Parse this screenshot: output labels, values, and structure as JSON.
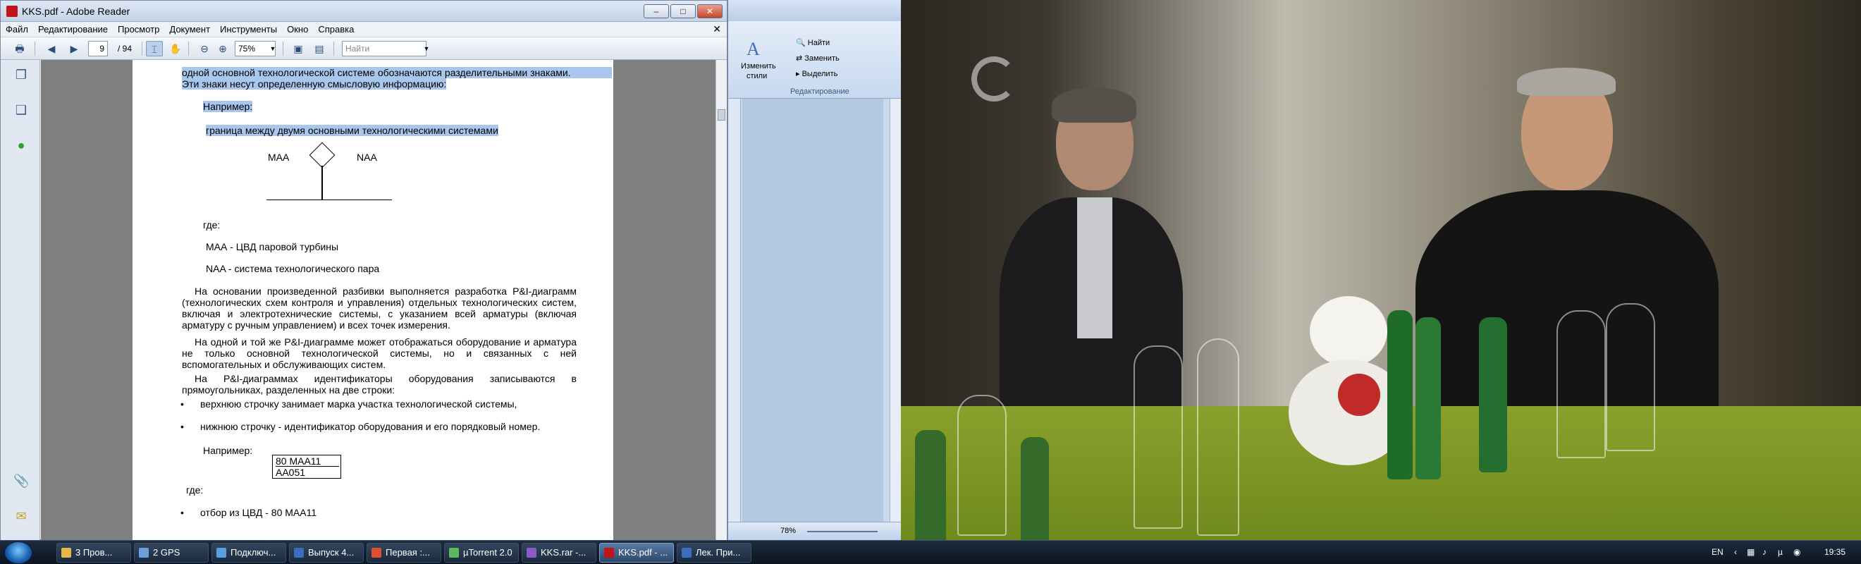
{
  "reader": {
    "title": "KKS.pdf - Adobe Reader",
    "window_buttons": [
      "–",
      "□",
      "✕"
    ],
    "menu": [
      "Файл",
      "Редактирование",
      "Просмотр",
      "Документ",
      "Инструменты",
      "Окно",
      "Справка"
    ],
    "toolbar": {
      "page_current": "9",
      "page_total": "/ 94",
      "zoom": "75%",
      "find_placeholder": "Найти"
    },
    "page": {
      "line1": "одной основной технологической системе обозначаются разделительными знаками.",
      "line2": "Эти знаки несут определенную смысловую информацию:",
      "example1": "Например:",
      "boundary": "граница между двумя основными технологическими системами",
      "diag_left": "МАА",
      "diag_right": "NAA",
      "where1": "где:",
      "def1": "МАА - ЦВД паровой турбины",
      "def2": "NAA - система технологического пара",
      "para1": "На основании произведенной разбивки выполняется разработка P&I-диаграмм (технологических схем контроля и управления) отдельных технологических систем, включая и электротехнические системы, с указанием всей арматуры (включая арматуру с ручным управлением) и всех точек измерения.",
      "para2": "На одной и той же P&I-диаграмме может отображаться оборудование и арматура не только основной технологической системы, но и связанных с ней вспомогательных и обслуживающих систем.",
      "para3": "На P&I-диаграммах идентификаторы оборудования записываются в прямоугольниках, разделенных на две строки:",
      "bullet1": "верхнюю строчку занимает марка участка технологической системы,",
      "bullet2": "нижнюю строчку - идентификатор оборудования и его порядковый номер.",
      "example2": "Например:",
      "box_top": "80 MAA11",
      "box_bottom": "AA051",
      "where2": "где:",
      "bullet3": "отбор из ЦВД - 80 МАА11"
    }
  },
  "word": {
    "styles_label_1": "Изменить",
    "styles_label_2": "стили",
    "find": "Найти",
    "replace": "Заменить",
    "select": "Выделить",
    "group_label": "Редактирование",
    "zoom": "78%"
  },
  "taskbar": {
    "items": [
      {
        "label": "3 Пров...",
        "color": "#e8b64a"
      },
      {
        "label": "2 GPS",
        "color": "#6aa0d8"
      },
      {
        "label": "Подключ...",
        "color": "#5aa0e0"
      },
      {
        "label": "Выпуск 4...",
        "color": "#3a6fc0"
      },
      {
        "label": "Первая :...",
        "color": "#e05030"
      },
      {
        "label": "µTorrent 2.0",
        "color": "#5cb85c"
      },
      {
        "label": "KKS.rar -...",
        "color": "#8a5ac8"
      },
      {
        "label": "KKS.pdf - ...",
        "color": "#c0131a"
      },
      {
        "label": "Лек. При...",
        "color": "#3a6fc0"
      }
    ],
    "language": "EN",
    "clock": "19:35"
  }
}
